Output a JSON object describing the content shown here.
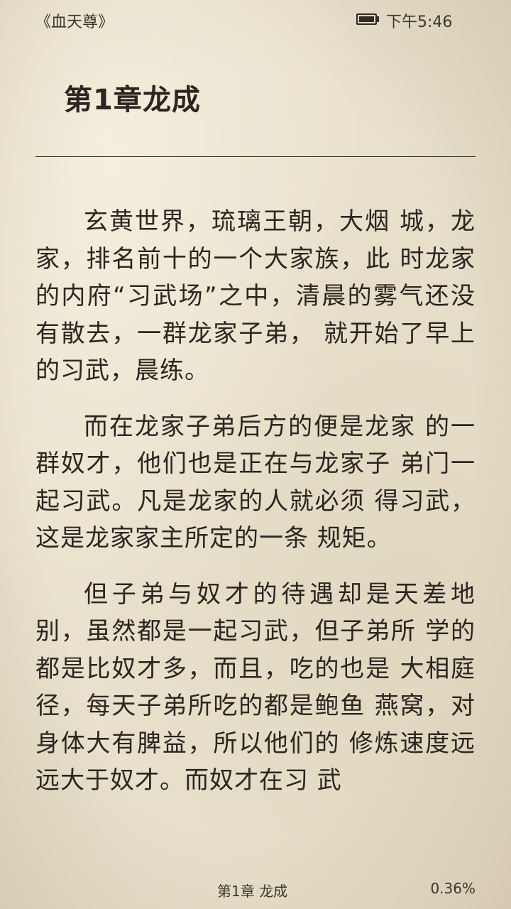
{
  "status_bar": {
    "book_title": "《血天尊》",
    "battery_icon": "battery-full-icon",
    "time": "下午5:46"
  },
  "chapter": {
    "title": "第1章龙成"
  },
  "paragraphs": [
    "玄黄世界，琉璃王朝，大烟 城，龙家，排名前十的一个大家族，此 时龙家的内府“习武场”之中，清晨的雾气还没有散去，一群龙家子弟， 就开始了早上的习武，晨练。",
    "而在龙家子弟后方的便是龙家 的一群奴才，他们也是正在与龙家子 弟门一起习武。凡是龙家的人就必须 得习武，这是龙家家主所定的一条 规矩。",
    "但子弟与奴才的待遇却是天差地别，虽然都是一起习武，但子弟所 学的都是比奴才多，而且，吃的也是 大相庭径，每天子弟所吃的都是鲍鱼 燕窝，对身体大有脾益，所以他们的 修炼速度远远大于奴才。而奴才在习 武"
  ],
  "footer": {
    "chapter_label": "第1章 龙成",
    "progress": "0.36%"
  },
  "colors": {
    "paper": "#e9e1cd",
    "text": "#2a2620"
  }
}
